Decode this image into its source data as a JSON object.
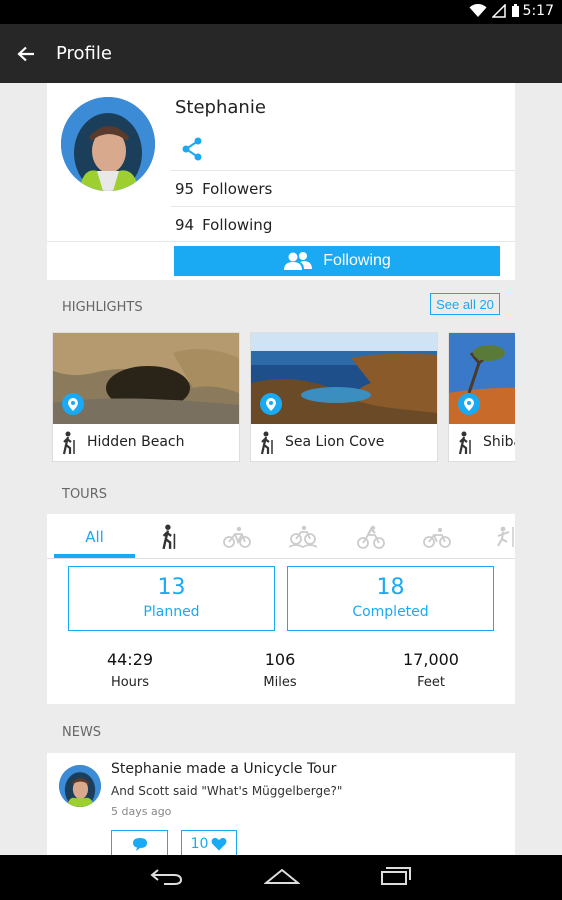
{
  "status": {
    "time": "5:17"
  },
  "appbar": {
    "title": "Profile"
  },
  "profile": {
    "name": "Stephanie",
    "followers_count": "95",
    "followers_label": "Followers",
    "following_count": "94",
    "following_label": "Following",
    "follow_button": "Following"
  },
  "highlights": {
    "label": "HIGHLIGHTS",
    "see_all": "See all 20",
    "items": [
      {
        "name": "Hidden Beach"
      },
      {
        "name": "Sea Lion Cove"
      },
      {
        "name": "Shiba"
      }
    ]
  },
  "tours": {
    "label": "TOURS",
    "tabs": [
      "All",
      "hiking-icon",
      "road-bike-icon",
      "mountain-bike-icon",
      "cycling-icon",
      "touring-bike-icon",
      "climbing-icon"
    ],
    "all_tab": "All",
    "planned_count": "13",
    "planned_label": "Planned",
    "completed_count": "18",
    "completed_label": "Completed",
    "duration": "44:29",
    "duration_label": "Hours",
    "distance": "106",
    "distance_label": "Miles",
    "elevation": "17,000",
    "elevation_label": "Feet"
  },
  "news": {
    "label": "NEWS",
    "items": [
      {
        "title": "Stephanie made a Unicycle Tour",
        "comment": "And Scott said \"What's Müggelberge?\"",
        "time": "5 days ago",
        "likes": "10"
      }
    ]
  },
  "colors": {
    "accent": "#1aa9f3",
    "appbar": "#272727",
    "background": "#ececec"
  }
}
